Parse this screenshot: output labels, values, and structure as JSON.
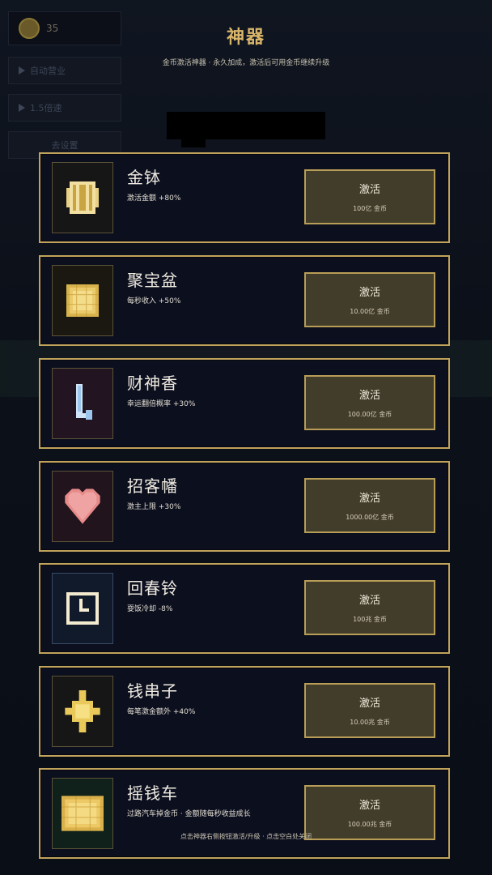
{
  "hud": {
    "coin_count": "35",
    "buttons": [
      {
        "label": "自动营业"
      },
      {
        "label": "1.5倍速"
      },
      {
        "label": "去设置"
      }
    ]
  },
  "header": {
    "title": "神器",
    "subtitle": "金币激活神器 · 永久加成，激活后可用金币继续升级"
  },
  "artifacts": [
    {
      "name": "金钵",
      "desc": "激活金额 +80%",
      "action": "激活",
      "price": "100亿 金币",
      "icon": "gold-bowl-icon",
      "frame_color": "#161616"
    },
    {
      "name": "聚宝盆",
      "desc": "每秒收入 +50%",
      "action": "激活",
      "price": "10.00亿 金币",
      "icon": "treasure-basin-icon",
      "frame_color": "#1a1810"
    },
    {
      "name": "财神香",
      "desc": "幸运翻倍概率 +30%",
      "action": "激活",
      "price": "100.00亿 金币",
      "icon": "incense-icon",
      "frame_color": "#221420"
    },
    {
      "name": "招客幡",
      "desc": "激主上限 +30%",
      "action": "激活",
      "price": "1000.00亿 金币",
      "icon": "heart-banner-icon",
      "frame_color": "#22141c"
    },
    {
      "name": "回春铃",
      "desc": "耍饭冷却 -8%",
      "action": "激活",
      "price": "100兆 金币",
      "icon": "bell-icon",
      "frame_color": "#101a2a"
    },
    {
      "name": "钱串子",
      "desc": "每笔激金额外 +40%",
      "action": "激活",
      "price": "10.00兆 金币",
      "icon": "coin-string-icon",
      "frame_color": "#161616"
    },
    {
      "name": "摇钱车",
      "desc": "过路汽车掉金币 · 金额随每秒收益成长",
      "action": "激活",
      "price": "100.00兆 金币",
      "icon": "money-cart-icon",
      "frame_color": "#10201a"
    }
  ],
  "footer": {
    "hint": "点击神器右侧按钮激活/升级 · 点击空白处关闭"
  },
  "colors": {
    "accent_gold": "#c1a35b",
    "title_gold": "#d9b56a",
    "button_bg": "#423c2b",
    "card_bg": "#0c0f1e"
  }
}
